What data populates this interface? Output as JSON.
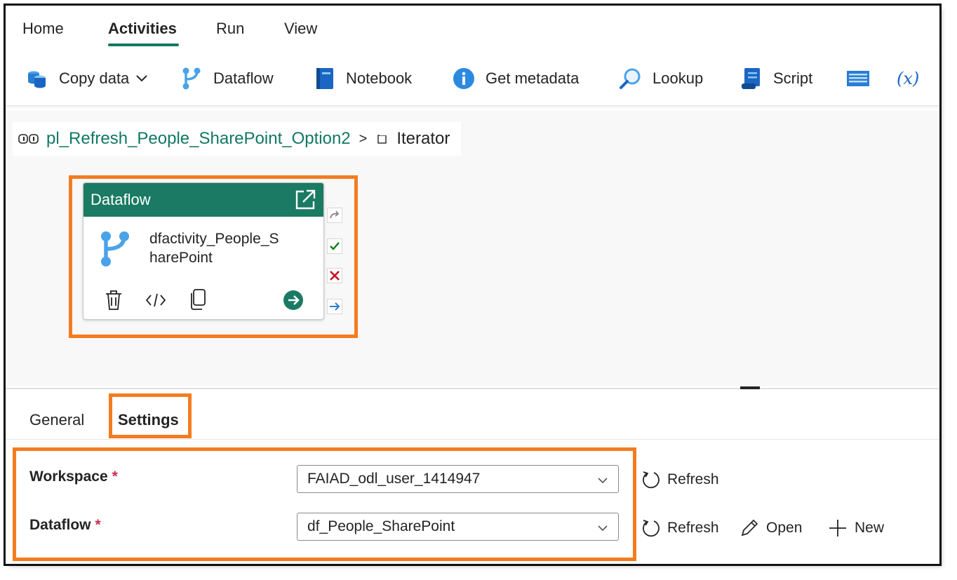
{
  "menu": {
    "tabs": [
      {
        "label": "Home"
      },
      {
        "label": "Activities"
      },
      {
        "label": "Run"
      },
      {
        "label": "View"
      }
    ],
    "active": "Activities"
  },
  "toolbar": {
    "copy_data": "Copy data",
    "dataflow": "Dataflow",
    "notebook": "Notebook",
    "get_metadata": "Get metadata",
    "lookup": "Lookup",
    "script": "Script",
    "variable_glyph": "(𝑥)"
  },
  "breadcrumb": {
    "pipeline": "pl_Refresh_People_SharePoint_Option2",
    "separator": ">",
    "current": "Iterator"
  },
  "activity": {
    "type_label": "Dataflow",
    "name": "dfactivity_People_SharePoint",
    "name_line1": "dfactivity_People_S",
    "name_line2": "harePoint"
  },
  "pane": {
    "tabs": [
      {
        "label": "General"
      },
      {
        "label": "Settings"
      }
    ],
    "active": "Settings"
  },
  "settings": {
    "workspace": {
      "label": "Workspace",
      "required_mark": "*",
      "value": "FAIAD_odl_user_1414947",
      "refresh_label": "Refresh"
    },
    "dataflow": {
      "label": "Dataflow",
      "required_mark": "*",
      "value": "df_People_SharePoint",
      "refresh_label": "Refresh",
      "open_label": "Open",
      "new_label": "New"
    }
  },
  "colors": {
    "accent": "#117865",
    "card_header": "#1a7a63",
    "highlight": "#f47c20",
    "required": "#c4314b"
  }
}
